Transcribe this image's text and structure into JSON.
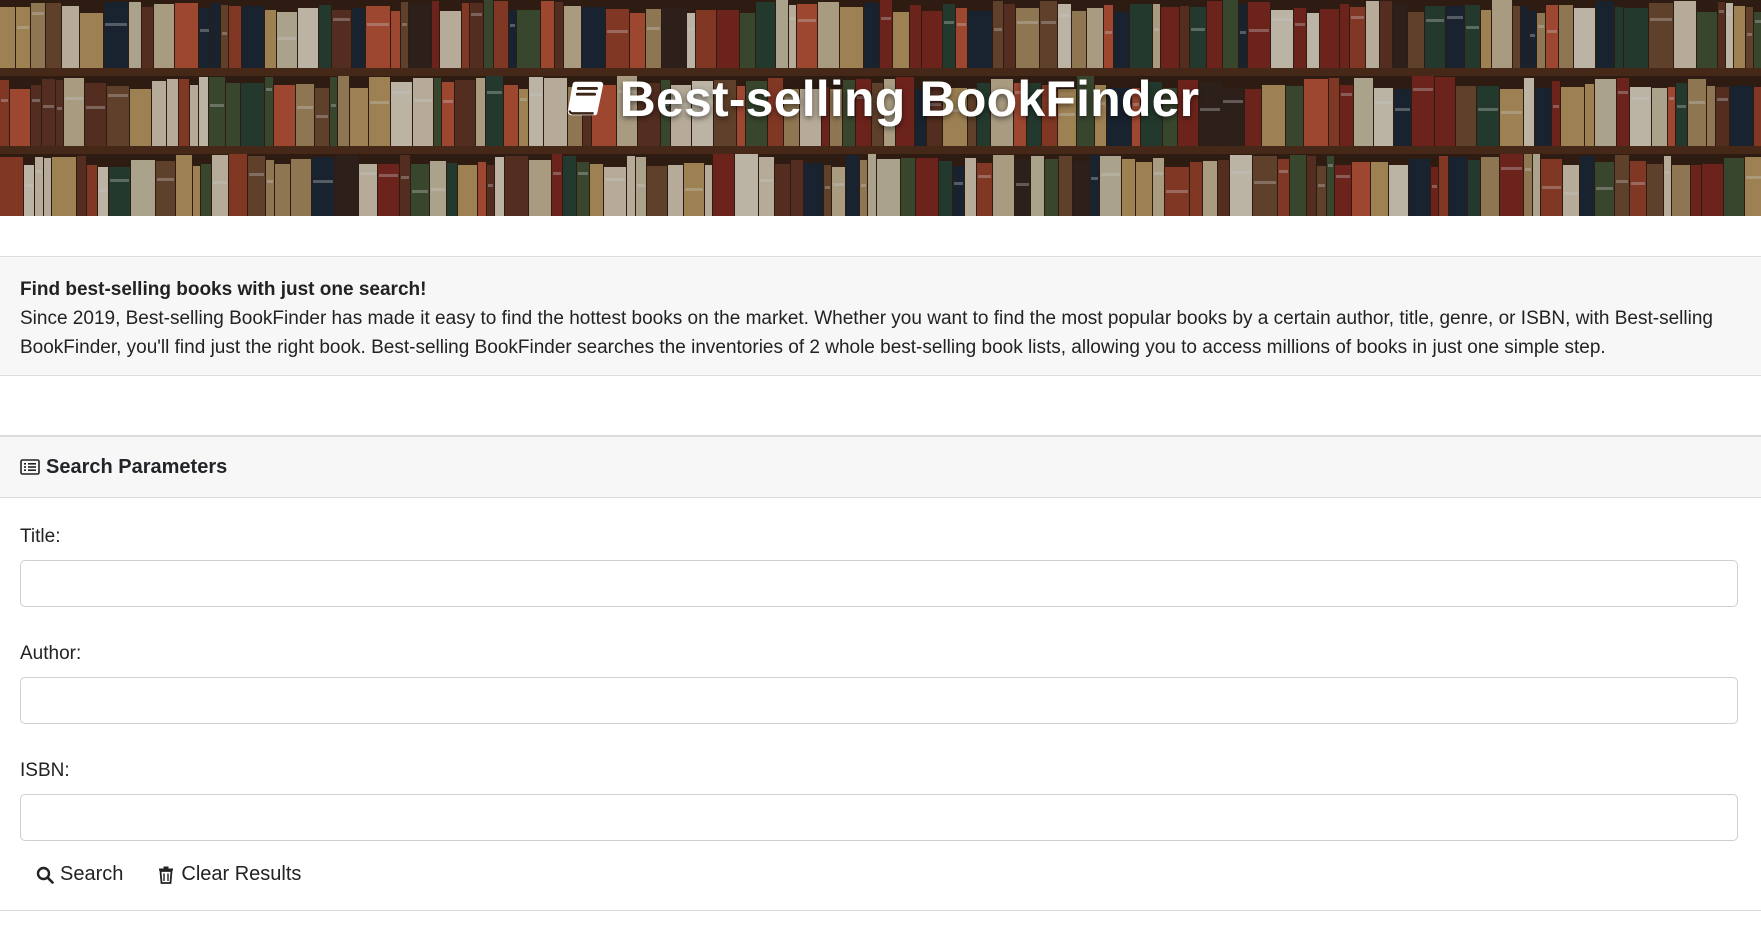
{
  "hero": {
    "title": "Best-selling BookFinder",
    "icon": "book-icon"
  },
  "intro": {
    "lead": "Find best-selling books with just one search!",
    "body": "Since 2019, Best-selling BookFinder has made it easy to find the hottest books on the market. Whether you want to find the most popular books by a certain author, title, genre, or ISBN, with Best-selling BookFinder, you'll find just the right book. Best-selling BookFinder searches the inventories of 2 whole best-selling book lists, allowing you to access millions of books in just one simple step."
  },
  "search": {
    "header": "Search Parameters",
    "header_icon": "list-alt-icon",
    "fields": [
      {
        "label": "Title:",
        "value": "",
        "placeholder": ""
      },
      {
        "label": "Author:",
        "value": "",
        "placeholder": ""
      },
      {
        "label": "ISBN:",
        "value": "",
        "placeholder": ""
      }
    ],
    "search_label": "Search",
    "clear_label": "Clear Results"
  },
  "colors": {
    "panel_bg": "#f7f7f7",
    "border": "#dcdcdc",
    "text": "#222222"
  }
}
